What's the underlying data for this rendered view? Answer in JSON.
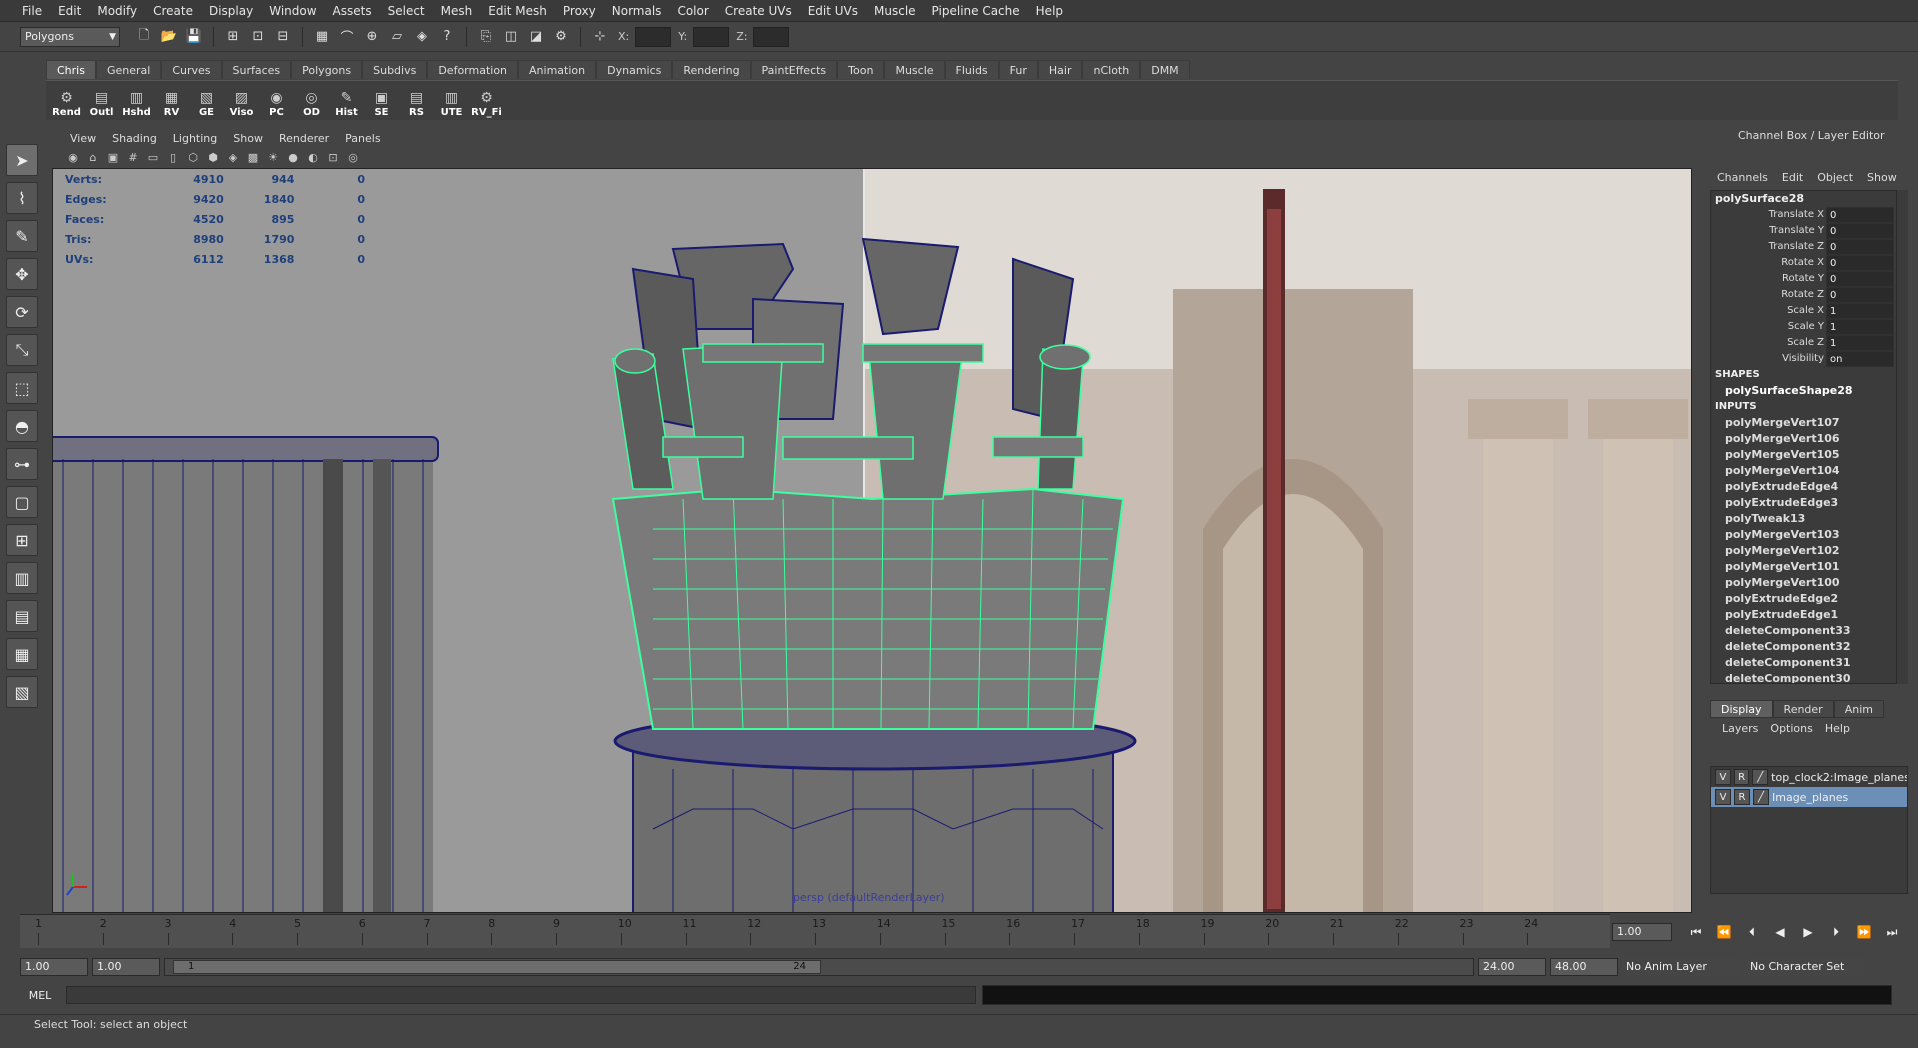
{
  "menubar": [
    "File",
    "Edit",
    "Modify",
    "Create",
    "Display",
    "Window",
    "Assets",
    "Select",
    "Mesh",
    "Edit Mesh",
    "Proxy",
    "Normals",
    "Color",
    "Create UVs",
    "Edit UVs",
    "Muscle",
    "Pipeline Cache",
    "Help"
  ],
  "statusline": {
    "mode": "Polygons",
    "x_label": "X:",
    "y_label": "Y:",
    "z_label": "Z:"
  },
  "shelf": {
    "tabs": [
      "Chris",
      "General",
      "Curves",
      "Surfaces",
      "Polygons",
      "Subdivs",
      "Deformation",
      "Animation",
      "Dynamics",
      "Rendering",
      "PaintEffects",
      "Toon",
      "Muscle",
      "Fluids",
      "Fur",
      "Hair",
      "nCloth",
      "DMM"
    ],
    "active_tab": "Chris",
    "buttons": [
      "Rend",
      "Outl",
      "Hshd",
      "RV",
      "GE",
      "Viso",
      "PC",
      "OD",
      "Hist",
      "SE",
      "RS",
      "UTE",
      "RV_Fi"
    ]
  },
  "panel": {
    "menus": [
      "View",
      "Shading",
      "Lighting",
      "Show",
      "Renderer",
      "Panels"
    ],
    "camera_label": "persp (defaultRenderLayer)"
  },
  "hud": [
    {
      "label": "Verts:",
      "total": "4910",
      "selected": "944",
      "comp": "0"
    },
    {
      "label": "Edges:",
      "total": "9420",
      "selected": "1840",
      "comp": "0"
    },
    {
      "label": "Faces:",
      "total": "4520",
      "selected": "895",
      "comp": "0"
    },
    {
      "label": "Tris:",
      "total": "8980",
      "selected": "1790",
      "comp": "0"
    },
    {
      "label": "UVs:",
      "total": "6112",
      "selected": "1368",
      "comp": "0"
    }
  ],
  "channelbox": {
    "title": "Channel Box / Layer Editor",
    "menus": [
      "Channels",
      "Edit",
      "Object",
      "Show"
    ],
    "node": "polySurface28",
    "attributes": [
      {
        "name": "Translate X",
        "value": "0"
      },
      {
        "name": "Translate Y",
        "value": "0"
      },
      {
        "name": "Translate Z",
        "value": "0"
      },
      {
        "name": "Rotate X",
        "value": "0"
      },
      {
        "name": "Rotate Y",
        "value": "0"
      },
      {
        "name": "Rotate Z",
        "value": "0"
      },
      {
        "name": "Scale X",
        "value": "1"
      },
      {
        "name": "Scale Y",
        "value": "1"
      },
      {
        "name": "Scale Z",
        "value": "1"
      },
      {
        "name": "Visibility",
        "value": "on"
      }
    ],
    "shapes_heading": "SHAPES",
    "shape": "polySurfaceShape28",
    "inputs_heading": "INPUTS",
    "inputs": [
      "polyMergeVert107",
      "polyMergeVert106",
      "polyMergeVert105",
      "polyMergeVert104",
      "polyExtrudeEdge4",
      "polyExtrudeEdge3",
      "polyTweak13",
      "polyMergeVert103",
      "polyMergeVert102",
      "polyMergeVert101",
      "polyMergeVert100",
      "polyExtrudeEdge2",
      "polyExtrudeEdge1",
      "deleteComponent33",
      "deleteComponent32",
      "deleteComponent31",
      "deleteComponent30"
    ]
  },
  "layer_editor": {
    "tabs": [
      "Display",
      "Render",
      "Anim"
    ],
    "active_tab": "Display",
    "menus": [
      "Layers",
      "Options",
      "Help"
    ],
    "layers": [
      {
        "v": "V",
        "r": "R",
        "name": "top_clock2:Image_planes",
        "selected": false
      },
      {
        "v": "V",
        "r": "R",
        "name": "Image_planes",
        "selected": true
      }
    ]
  },
  "timeline": {
    "ticks": [
      "1",
      "2",
      "3",
      "4",
      "5",
      "6",
      "7",
      "8",
      "9",
      "10",
      "11",
      "12",
      "13",
      "14",
      "15",
      "16",
      "17",
      "18",
      "19",
      "20",
      "21",
      "22",
      "23",
      "24"
    ],
    "current_frame": "1.00"
  },
  "range": {
    "start": "1.00",
    "inner_start": "1.00",
    "bar_start": "1",
    "bar_end": "24",
    "end": "24.00",
    "outer_end": "48.00",
    "anim_layer": "No Anim Layer",
    "character_set": "No Character Set"
  },
  "cmdline": {
    "language": "MEL"
  },
  "helpline": "Select Tool: select an object",
  "colors": {
    "hud_text": "#1f3f7a",
    "wire_selected": "#3cff9e",
    "wire_unselected": "#1a1a6e",
    "layer_selected": "#6b8fb7"
  }
}
